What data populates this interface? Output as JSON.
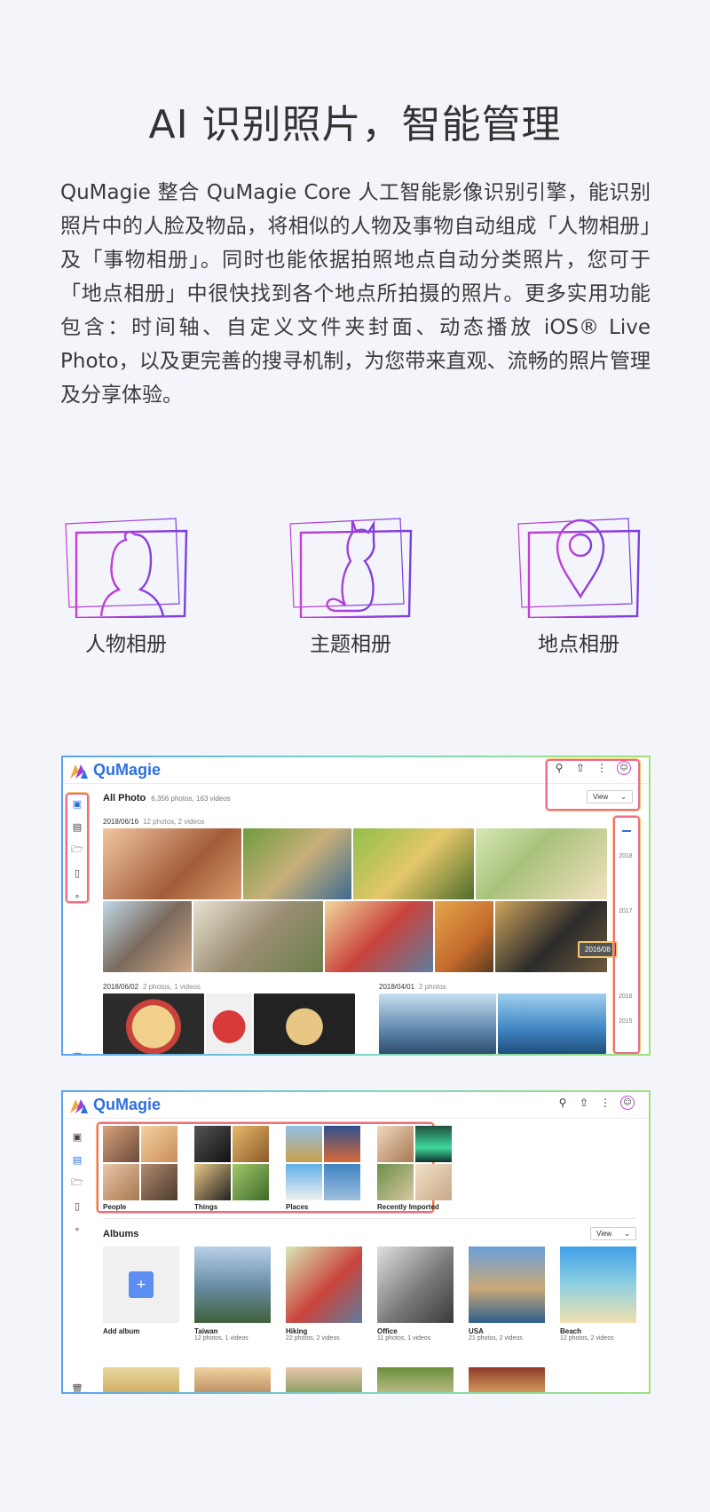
{
  "heading": "AI 识别照片，智能管理",
  "intro": "QuMagie 整合 QuMagie Core 人工智能影像识别引擎，能识别照片中的人脸及物品，将相似的人物及事物自动组成「人物相册」及「事物相册」。同时也能依据拍照地点自动分类照片，您可于「地点相册」中很快找到各个地点所拍摄的照片。更多实用功能包含：时间轴、自定义文件夹封面、动态播放 iOS® Live Photo，以及更完善的搜寻机制，为您带来直观、流畅的照片管理及分享体验。",
  "features": [
    {
      "label": "人物相册",
      "icon": "person-album-icon"
    },
    {
      "label": "主题相册",
      "icon": "cat-album-icon"
    },
    {
      "label": "地点相册",
      "icon": "location-album-icon"
    }
  ],
  "shot1": {
    "app_name": "QuMagie",
    "page_title": "All Photo",
    "page_count": "6,356 photos, 163 videos",
    "view_label": "View",
    "groups": [
      {
        "date": "2018/06/16",
        "count": "12 photos, 2 videos"
      },
      {
        "date": "2018/06/02",
        "count": "2 photos, 1 videos"
      },
      {
        "date": "2018/04/01",
        "count": "2 photos"
      }
    ],
    "timeline_years": [
      "2018",
      "2017",
      "2016",
      "2015"
    ],
    "timeline_tooltip": "2016/08"
  },
  "shot2": {
    "app_name": "QuMagie",
    "smart_albums": [
      "People",
      "Things",
      "Places",
      "Recently Imported"
    ],
    "albums_title": "Albums",
    "view_label": "View",
    "albums": [
      {
        "name": "Add album",
        "meta": ""
      },
      {
        "name": "Taiwan",
        "meta": "12 photos, 1 videos"
      },
      {
        "name": "Hiking",
        "meta": "22 photos, 2 videos"
      },
      {
        "name": "Office",
        "meta": "11 photos, 1 videos"
      },
      {
        "name": "USA",
        "meta": "21 photos, 2 videos"
      },
      {
        "name": "Beach",
        "meta": "12 photos, 2 videos"
      }
    ]
  },
  "colors": {
    "accent": "#9b3fd8",
    "brand": "#2f6fe0",
    "highlight": "#f06a8c"
  }
}
